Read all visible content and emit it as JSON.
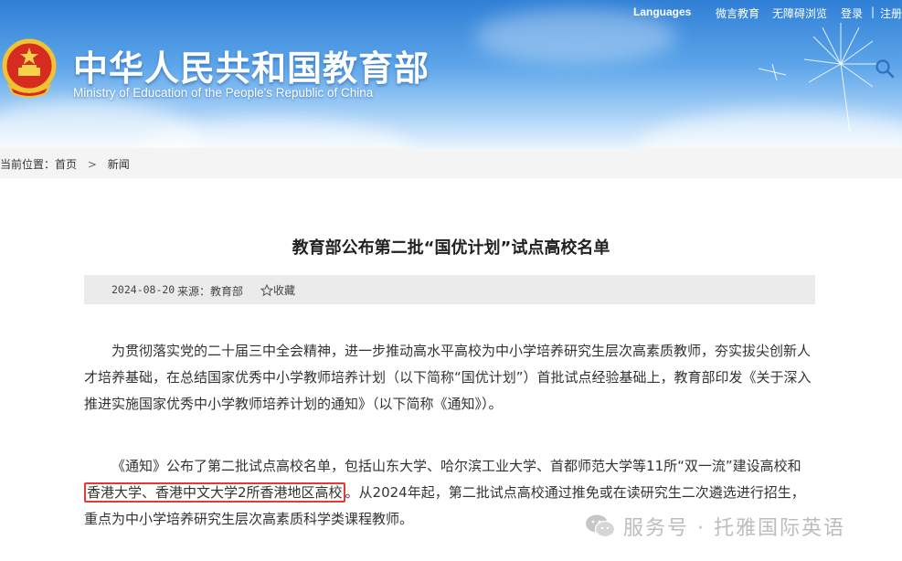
{
  "header": {
    "languages": "Languages",
    "links": [
      "微言教育",
      "无障碍浏览",
      "登录",
      "|",
      "注册"
    ],
    "title_cn": "中华人民共和国教育部",
    "title_en": "Ministry of Education of the People's Republic of China"
  },
  "breadcrumb": {
    "prefix": "当前位置：",
    "home": "首页",
    "separator": ">",
    "current": "新闻"
  },
  "article": {
    "title": "教育部公布第二批“国优计划”试点高校名单",
    "date": "2024-08-20",
    "source": "来源：教育部",
    "favorite": "收藏",
    "p1": "为贯彻落实党的二十届三中全会精神，进一步推动高水平高校为中小学培养研究生层次高素质教师，夯实拔尖创新人才培养基础，在总结国家优秀中小学教师培养计划（以下简称“国优计划”）首批试点经验基础上，教育部印发《关于深入推进实施国家优秀中小学教师培养计划的通知》（以下简称《通知》）。",
    "p2_before": "《通知》公布了第二批试点高校名单，包括山东大学、哈尔滨工业大学、首都师范大学等11所“双一流”建设高校和",
    "p2_highlight": "香港大学、香港中文大学2所香港地区高校",
    "p2_after": "。从2024年起，第二批试点高校通过推免或在读研究生二次遴选进行招生，重点为中小学培养研究生层次高素质科学类课程教师。"
  },
  "watermark": "服务号 · 托雅国际英语",
  "colors": {
    "header_top": "#2f7fd6",
    "highlight_border": "#e53935",
    "meta_bg": "#ebebeb"
  }
}
